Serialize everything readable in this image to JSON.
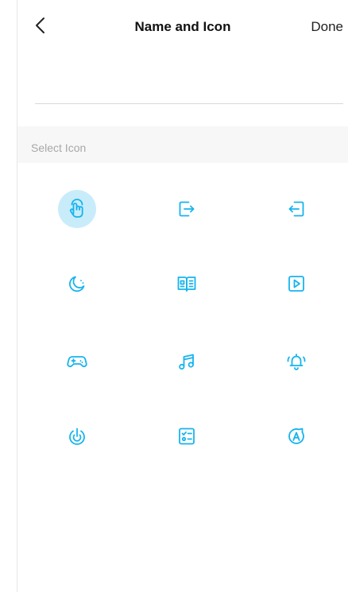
{
  "nav": {
    "title": "Name and Icon",
    "done_label": "Done"
  },
  "name_field": {
    "value": "",
    "placeholder": ""
  },
  "section": {
    "label": "Select Icon"
  },
  "icons": [
    {
      "name": "tap-hand-icon",
      "selected": true
    },
    {
      "name": "logout-icon",
      "selected": false
    },
    {
      "name": "login-icon",
      "selected": false
    },
    {
      "name": "moon-icon",
      "selected": false
    },
    {
      "name": "book-icon",
      "selected": false
    },
    {
      "name": "play-icon",
      "selected": false
    },
    {
      "name": "gamepad-icon",
      "selected": false
    },
    {
      "name": "music-note-icon",
      "selected": false
    },
    {
      "name": "bell-ringing-icon",
      "selected": false
    },
    {
      "name": "power-icon",
      "selected": false
    },
    {
      "name": "checklist-icon",
      "selected": false
    },
    {
      "name": "auto-rotate-icon",
      "selected": false
    }
  ],
  "colors": {
    "accent": "#16b4ee",
    "selected_bg": "#c9ecfa",
    "section_bg": "#f7f7f7"
  }
}
